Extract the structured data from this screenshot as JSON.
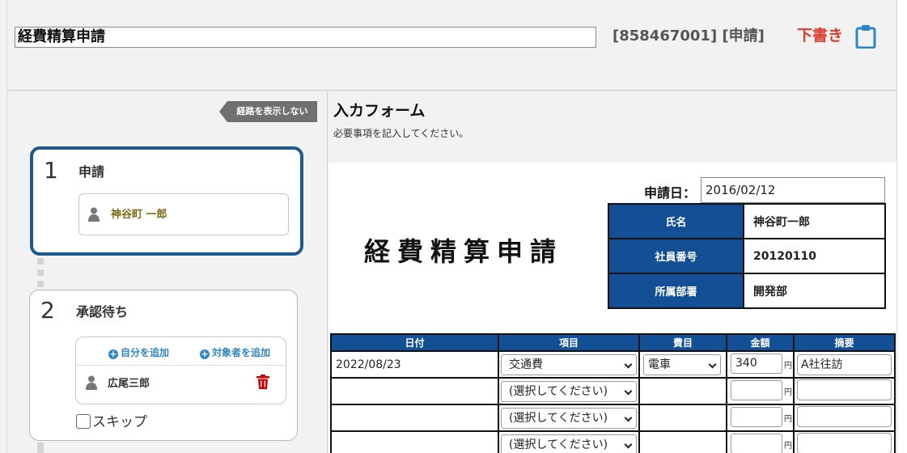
{
  "header": {
    "title_value": "経費精算申請",
    "doc_id": "[858467001] [申請]",
    "draft_label": "下書き"
  },
  "route": {
    "toggle_label": "経路を表示しない",
    "steps": [
      {
        "number": "1",
        "name": "申請",
        "person": "神谷町 一郎"
      },
      {
        "number": "2",
        "name": "承認待ち",
        "add_self": "自分を追加",
        "add_target": "対象者を追加",
        "person": "広尾三郎",
        "skip_label": "スキップ"
      }
    ]
  },
  "form": {
    "title": "入カフォーム",
    "subtitle": "必要事項を記入してください。",
    "apply_date_label": "申請日：",
    "apply_date": "2016/02/12",
    "big_title": "経費精算申請",
    "info": [
      {
        "label": "氏名",
        "value": "神谷町一郎"
      },
      {
        "label": "社員番号",
        "value": "20120110"
      },
      {
        "label": "所属部署",
        "value": "開発部"
      }
    ],
    "columns": [
      "日付",
      "項目",
      "費目",
      "金額",
      "摘要"
    ],
    "rows": [
      {
        "date": "2022/08/23",
        "item": "交通費",
        "cost": "電車",
        "amount": "340",
        "note": "A社往訪"
      },
      {
        "date": "",
        "item": "(選択してください)",
        "cost": "",
        "amount": "",
        "note": ""
      },
      {
        "date": "",
        "item": "(選択してください)",
        "cost": "",
        "amount": "",
        "note": ""
      },
      {
        "date": "",
        "item": "(選択してください)",
        "cost": "",
        "amount": "",
        "note": ""
      }
    ],
    "yen": "円"
  },
  "colors": {
    "primary": "#124f95",
    "draft": "#e03c2e",
    "link": "#2f86c7",
    "active_border": "#1d5a92"
  },
  "icons": [
    "clipboard-icon",
    "person-icon",
    "plus-circle-icon",
    "trash-icon",
    "chevron-down-icon",
    "arrow-left-icon"
  ]
}
